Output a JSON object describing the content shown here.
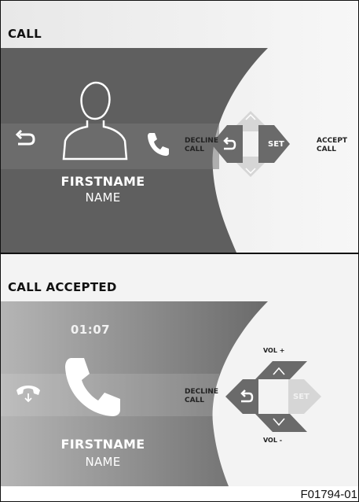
{
  "panels": {
    "call": {
      "title": "CALL",
      "contact_first": "FIRSTNAME",
      "contact_last": "NAME",
      "left_action": "DECLINE\nCALL",
      "right_action": "ACCEPT\nCALL",
      "set_key": "SET",
      "icons": [
        "back-arrow-icon",
        "person-silhouette-icon",
        "phone-handset-icon"
      ]
    },
    "accepted": {
      "title": "CALL ACCEPTED",
      "timer": "01:07",
      "contact_first": "FIRSTNAME",
      "contact_last": "NAME",
      "left_action": "DECLINE\nCALL",
      "vol_up": "VOL +",
      "vol_down": "VOL -",
      "set_key": "SET",
      "icons": [
        "hang-up-icon",
        "large-phone-handset-icon",
        "back-arrow-icon"
      ]
    }
  },
  "figure_code": "F01794-01",
  "colors": {
    "dark_panel": "#5f5f5f",
    "gradient_panel": "#8c8c8c",
    "dpad_active": "#6a6a6a",
    "dpad_inactive": "#d6d6d6"
  }
}
